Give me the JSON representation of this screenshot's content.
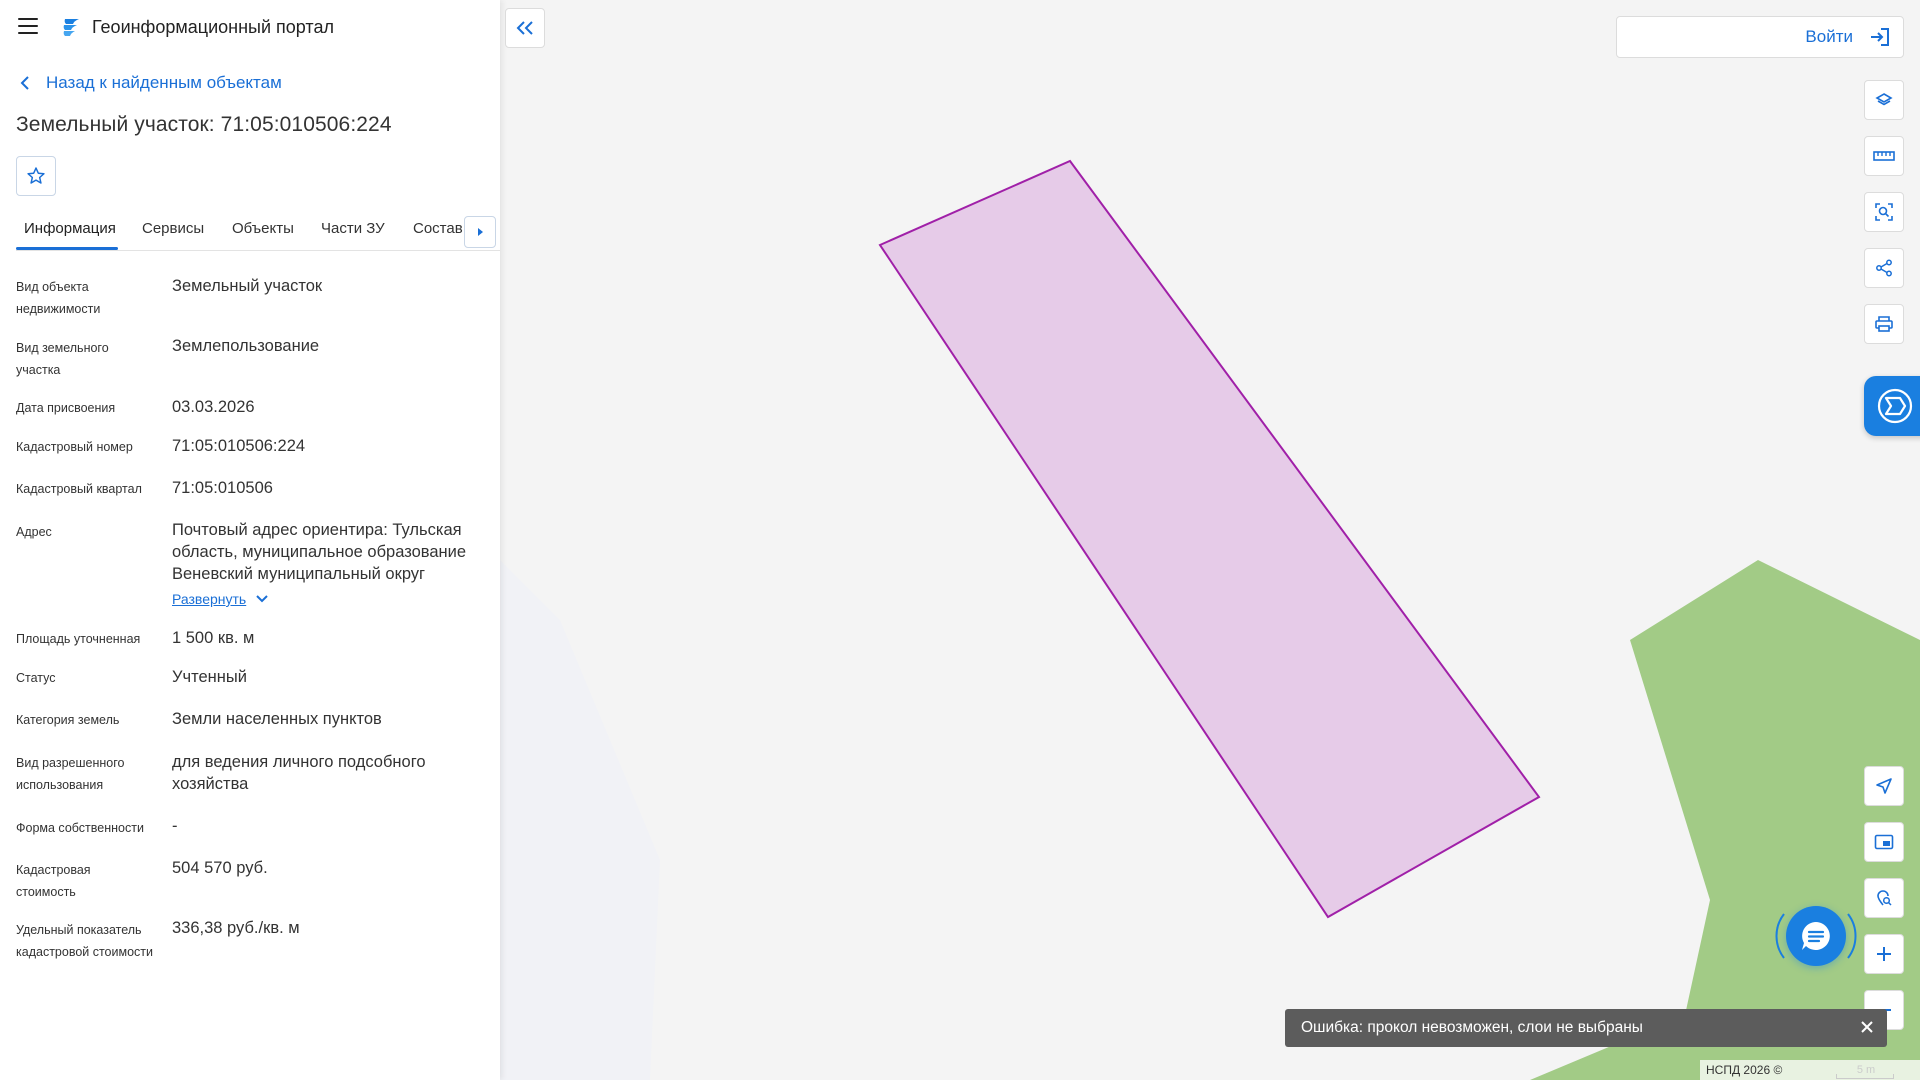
{
  "app": {
    "title": "Геоинформационный портал"
  },
  "nav": {
    "back_label": "Назад к найденным объектам"
  },
  "object": {
    "title": "Земельный участок: 71:05:010506:224"
  },
  "tabs": [
    {
      "label": "Информация",
      "active": true
    },
    {
      "label": "Сервисы"
    },
    {
      "label": "Объекты"
    },
    {
      "label": "Части ЗУ"
    },
    {
      "label": "Состав"
    }
  ],
  "properties": [
    {
      "label": "Вид объекта недвижимости",
      "value": "Земельный участок"
    },
    {
      "label": "Вид земельного участка",
      "value": "Землепользование"
    },
    {
      "label": "Дата присвоения",
      "value": "03.03.2026"
    },
    {
      "label": "Кадастровый номер",
      "value": "71:05:010506:224"
    },
    {
      "label": "Кадастровый квартал",
      "value": "71:05:010506"
    },
    {
      "label": "Адрес",
      "value": "Почтовый адрес ориентира: Тульская область, муниципальное образование Веневский муниципальный округ",
      "expand_label": "Развернуть"
    },
    {
      "label": "Площадь уточненная",
      "value": "1 500 кв. м"
    },
    {
      "label": "Статус",
      "value": "Учтенный"
    },
    {
      "label": "Категория земель",
      "value": "Земли населенных пунктов"
    },
    {
      "label": "Вид разрешенного использования",
      "value": "для ведения личного подсобного хозяйства"
    },
    {
      "label": "Форма собственности",
      "value": "-"
    },
    {
      "label": "Кадастровая стоимость",
      "value": "504 570 руб."
    },
    {
      "label": "Удельный показатель кадастровой стоимости",
      "value": "336,38 руб./кв. м"
    }
  ],
  "header": {
    "login_label": "Войти"
  },
  "map_tools": {
    "top": [
      "layers-icon",
      "ruler-icon",
      "area-search-icon",
      "share-icon",
      "print-icon"
    ],
    "bottom": [
      "navigate-icon",
      "minimap-icon",
      "location-search-icon",
      "zoom-in-icon",
      "zoom-out-icon"
    ]
  },
  "toast": {
    "message": "Ошибка: прокол невозможен, слои не выбраны"
  },
  "attribution": {
    "text": "НСПД 2026 ©",
    "scale": "5 m"
  },
  "colors": {
    "accent": "#1a6fd6",
    "parcel_stroke": "#a020a8",
    "parcel_fill": "#e6cbe8",
    "green": "#a2cb86"
  }
}
